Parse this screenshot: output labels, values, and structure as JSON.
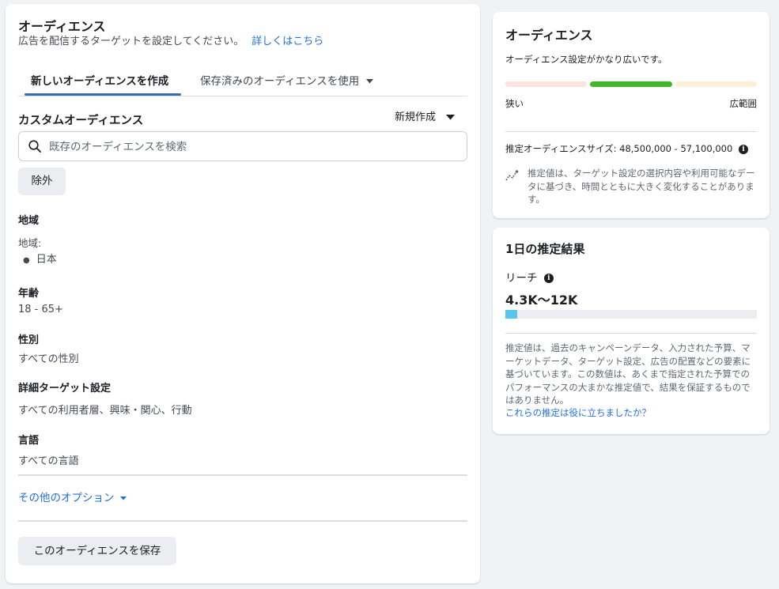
{
  "left_panel": {
    "title": "オーディエンス",
    "subtitle": "広告を配信するターゲットを設定してください。",
    "learn_more": "詳しくはこちら",
    "tabs": [
      {
        "label": "新しいオーディエンスを作成",
        "active": true
      },
      {
        "label": "保存済みのオーディエンスを使用",
        "active": false
      }
    ],
    "custom_audience": {
      "label": "カスタムオーディエンス",
      "create_new": "新規作成",
      "search_placeholder": "既存のオーディエンスを検索",
      "exclude_button": "除外"
    },
    "location": {
      "label": "地域",
      "sublabel": "地域:",
      "items": [
        "日本"
      ]
    },
    "age": {
      "label": "年齢",
      "value": "18 - 65+"
    },
    "gender": {
      "label": "性別",
      "value": "すべての性別"
    },
    "detailed_targeting": {
      "label": "詳細ターゲット設定",
      "value": "すべての利用者層、興味・関心、行動"
    },
    "language": {
      "label": "言語",
      "value": "すべての言語"
    },
    "more_options": "その他のオプション",
    "save_button": "このオーディエンスを保存"
  },
  "audience_card": {
    "title": "オーディエンス",
    "breadth_status": "オーディエンス設定がかなり広いです。",
    "breadth_level": 0.5,
    "narrow_label": "狭い",
    "broad_label": "広範囲",
    "size_text": "推定オーディエンスサイズ: 48,500,000 - 57,100,000",
    "note": "推定値は、ターゲット設定の選択内容や利用可能なデータに基づき、時間とともに大きく変化することがあります。",
    "colors": {
      "narrow": "#fbe3df",
      "mid": "#42b72a",
      "broad": "#fdf0d5"
    }
  },
  "daily_card": {
    "title": "1日の推定結果",
    "reach_label": "リーチ",
    "reach_value": "4.3K〜12K",
    "reach_fill": 0.047,
    "note": "推定値は、過去のキャンペーンデータ、入力された予算、マーケットデータ、ターゲット設定、広告の配置などの要素に基づいています。この数値は、あくまで指定された予算でのパフォーマンスの大まかな推定値で、結果を保証するものではありません。",
    "feedback_link": "これらの推定は役に立ちましたか？",
    "colors": {
      "fill": "#58c5ee",
      "track": "#ebedf0"
    }
  }
}
